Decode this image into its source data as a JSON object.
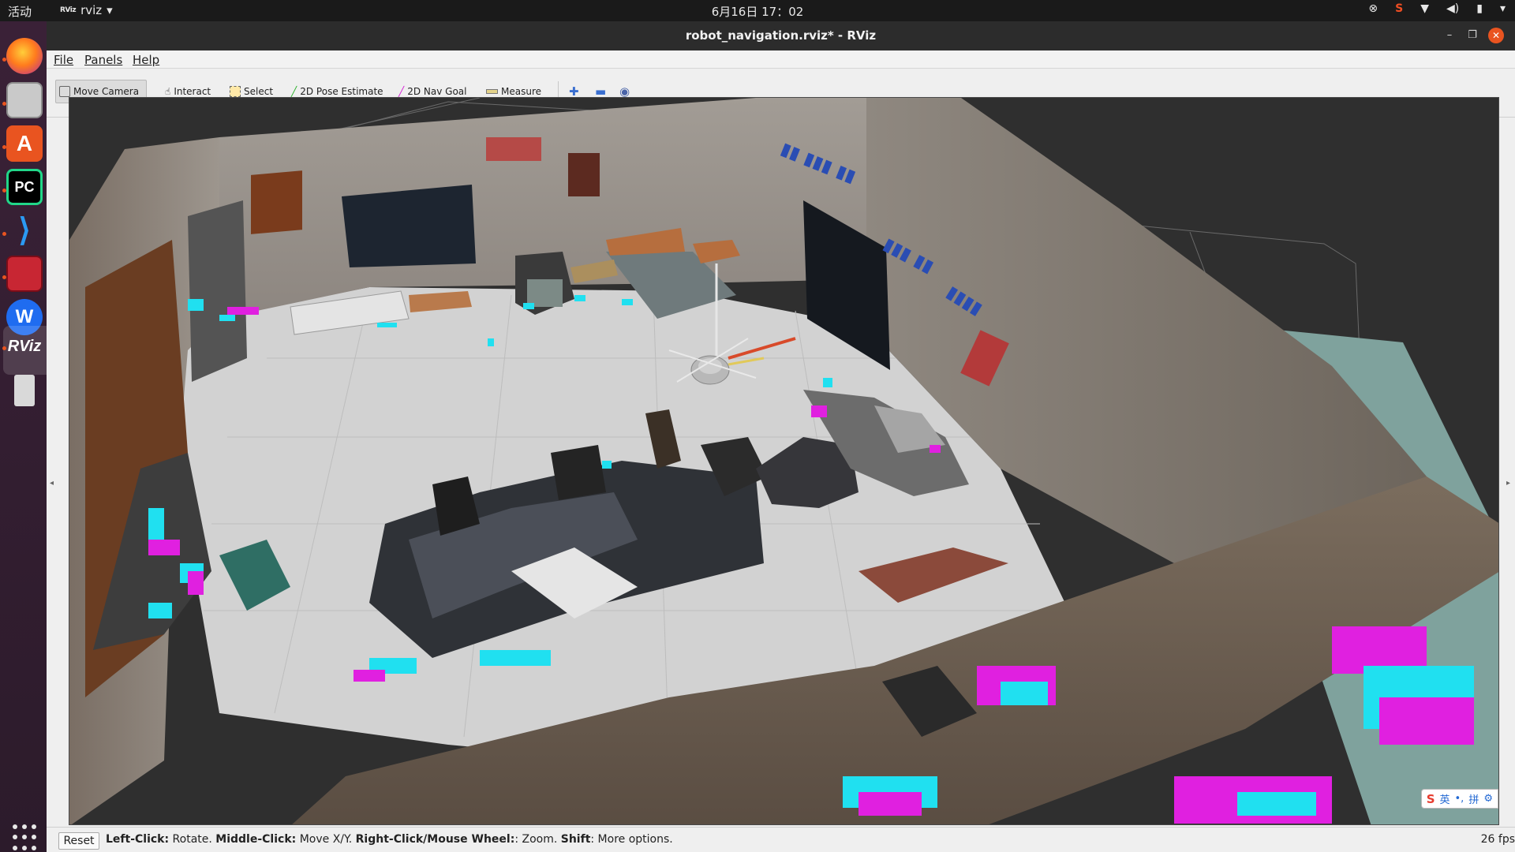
{
  "topbar": {
    "activities": "活动",
    "app_name": "rviz",
    "app_icon_text": "RViz",
    "clock": "6月16日 17：02"
  },
  "window": {
    "title": "robot_navigation.rviz* - RViz"
  },
  "menu": {
    "file": "File",
    "panels": "Panels",
    "help": "Help"
  },
  "toolbar": {
    "move_camera": "Move Camera",
    "interact": "Interact",
    "select": "Select",
    "pose_estimate": "2D Pose Estimate",
    "nav_goal": "2D Nav Goal",
    "measure": "Measure"
  },
  "dock": {
    "items": [
      "firefox-icon",
      "files-icon",
      "software-center-icon",
      "pycharm-icon",
      "vscode-icon",
      "presentation-icon",
      "wps-icon",
      "rviz-icon",
      "usb-drive-icon"
    ],
    "pycharm_text": "PC",
    "rviz_text": "RViz",
    "wps_text": "W"
  },
  "statusbar": {
    "reset": "Reset",
    "hint_left_click_label": "Left-Click:",
    "hint_left_click_text": " Rotate. ",
    "hint_middle_click_label": "Middle-Click:",
    "hint_middle_click_text": " Move X/Y. ",
    "hint_right_click_label": "Right-Click/Mouse Wheel:",
    "hint_right_click_text": ": Zoom. ",
    "hint_shift_label": "Shift",
    "hint_shift_text": ": More options.",
    "fps": "26 fps"
  },
  "ime": {
    "lang": "英",
    "mode": "拼"
  },
  "colors": {
    "accent": "#e95420",
    "costmap_magenta": "#e020e0",
    "costmap_cyan": "#20e0f0",
    "floor": "#d4d4d4",
    "wall": "#8a8278"
  }
}
